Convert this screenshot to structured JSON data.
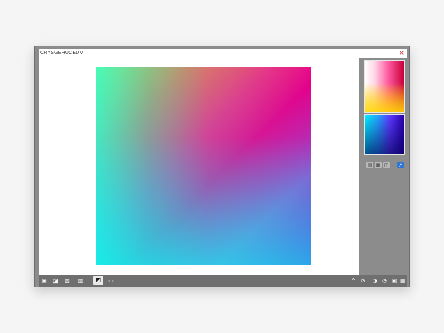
{
  "window": {
    "title": "CRYSGEHUCEDM",
    "close_label": "×"
  },
  "canvas": {
    "name": "gradient-canvas"
  },
  "side_panel": {
    "swatches": [
      "warm-gradient-swatch",
      "cool-gradient-swatch"
    ],
    "tools": [
      {
        "icon": "layers-icon",
        "glyph": "▤",
        "active": false
      },
      {
        "icon": "grid-icon",
        "glyph": "▦",
        "active": false
      },
      {
        "icon": "palette-icon",
        "glyph": "◫",
        "active": false
      },
      {
        "icon": "share-icon",
        "glyph": "↗",
        "active": true
      }
    ]
  },
  "taskbar": {
    "left_items": [
      {
        "icon": "file-icon",
        "glyph": "▣"
      },
      {
        "icon": "folder-icon",
        "glyph": "◪"
      },
      {
        "icon": "image-icon",
        "glyph": "▧"
      },
      {
        "icon": "window-icon",
        "glyph": "▥"
      },
      {
        "icon": "app-icon",
        "glyph": "◩",
        "boxed": true
      },
      {
        "icon": "extra-icon",
        "glyph": "▭"
      }
    ],
    "tray_items": [
      {
        "icon": "chevron-up-icon",
        "glyph": "⌃"
      },
      {
        "icon": "network-icon",
        "glyph": "⊙"
      },
      {
        "icon": "battery-icon",
        "glyph": "◑"
      },
      {
        "icon": "volume-icon",
        "glyph": "◔"
      },
      {
        "icon": "notification-icon",
        "glyph": "▣"
      },
      {
        "icon": "calendar-icon",
        "glyph": "▦"
      }
    ]
  }
}
